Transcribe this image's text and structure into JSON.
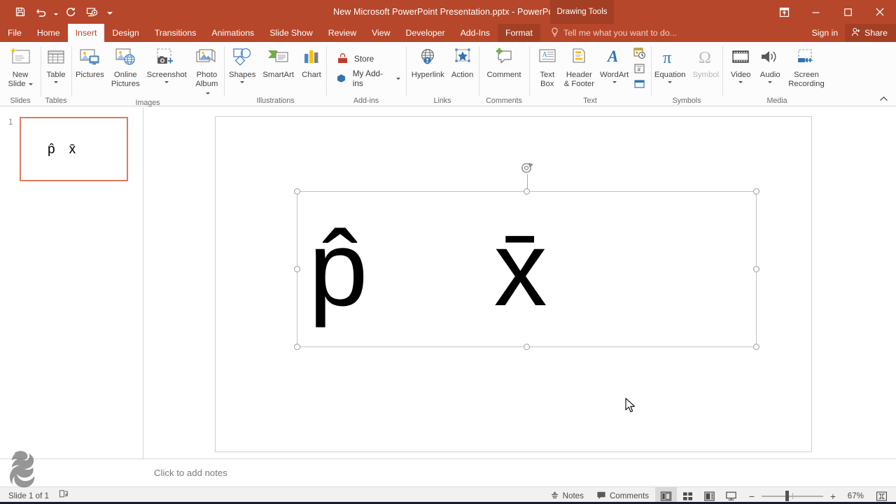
{
  "app": {
    "window_title": "New Microsoft PowerPoint Presentation.pptx - PowerPoint",
    "contextual_tabset": "Drawing Tools",
    "accent_color": "#b7472a",
    "contextual_color": "#a33f24"
  },
  "quick_access": {
    "items": [
      {
        "name": "save",
        "icon": "save-icon",
        "label": "Save"
      },
      {
        "name": "undo",
        "icon": "undo-icon",
        "label": "Undo"
      },
      {
        "name": "redo",
        "icon": "redo-icon",
        "label": "Redo"
      },
      {
        "name": "start-from-beginning",
        "icon": "slideshow-icon",
        "label": "Start From Beginning"
      },
      {
        "name": "customize",
        "icon": "chevron-down-icon",
        "label": "Customize Quick Access Toolbar"
      }
    ]
  },
  "window_controls": {
    "ribbon_display": "Ribbon Display Options",
    "minimize": "Minimize",
    "restore": "Restore Down",
    "close": "Close"
  },
  "tabs": [
    {
      "label": "File",
      "active": false,
      "contextual": false
    },
    {
      "label": "Home",
      "active": false,
      "contextual": false
    },
    {
      "label": "Insert",
      "active": true,
      "contextual": false
    },
    {
      "label": "Design",
      "active": false,
      "contextual": false
    },
    {
      "label": "Transitions",
      "active": false,
      "contextual": false
    },
    {
      "label": "Animations",
      "active": false,
      "contextual": false
    },
    {
      "label": "Slide Show",
      "active": false,
      "contextual": false
    },
    {
      "label": "Review",
      "active": false,
      "contextual": false
    },
    {
      "label": "View",
      "active": false,
      "contextual": false
    },
    {
      "label": "Developer",
      "active": false,
      "contextual": false
    },
    {
      "label": "Add-Ins",
      "active": false,
      "contextual": false
    },
    {
      "label": "Format",
      "active": false,
      "contextual": true
    }
  ],
  "tell_me": {
    "placeholder": "Tell me what you want to do...",
    "icon": "lightbulb-icon"
  },
  "account": {
    "sign_in": "Sign in",
    "share": "Share",
    "share_icon": "person-add-icon"
  },
  "ribbon": {
    "collapse_label": "Collapse the Ribbon",
    "groups": [
      {
        "name": "slides",
        "label": "Slides",
        "buttons": [
          {
            "label": "New\nSlide",
            "icon": "new-slide-icon",
            "dropdown": true,
            "disabled": false
          }
        ]
      },
      {
        "name": "tables",
        "label": "Tables",
        "buttons": [
          {
            "label": "Table",
            "icon": "table-icon",
            "dropdown": true,
            "disabled": false
          }
        ]
      },
      {
        "name": "images",
        "label": "Images",
        "buttons": [
          {
            "label": "Pictures",
            "icon": "pictures-icon",
            "dropdown": false,
            "disabled": false
          },
          {
            "label": "Online\nPictures",
            "icon": "online-pictures-icon",
            "dropdown": false,
            "disabled": false
          },
          {
            "label": "Screenshot",
            "icon": "screenshot-icon",
            "dropdown": true,
            "disabled": false
          },
          {
            "label": "Photo\nAlbum",
            "icon": "photo-album-icon",
            "dropdown": true,
            "disabled": false
          }
        ]
      },
      {
        "name": "illustrations",
        "label": "Illustrations",
        "buttons": [
          {
            "label": "Shapes",
            "icon": "shapes-icon",
            "dropdown": true,
            "disabled": false
          },
          {
            "label": "SmartArt",
            "icon": "smartart-icon",
            "dropdown": false,
            "disabled": false
          },
          {
            "label": "Chart",
            "icon": "chart-icon",
            "dropdown": false,
            "disabled": false
          }
        ]
      },
      {
        "name": "add-ins",
        "label": "Add-ins",
        "buttons": [
          {
            "label": "Store",
            "icon": "store-icon",
            "dropdown": false,
            "disabled": false
          },
          {
            "label": "My Add-ins",
            "icon": "my-addins-icon",
            "dropdown": true,
            "disabled": false
          }
        ]
      },
      {
        "name": "links",
        "label": "Links",
        "buttons": [
          {
            "label": "Hyperlink",
            "icon": "hyperlink-icon",
            "dropdown": false,
            "disabled": false
          },
          {
            "label": "Action",
            "icon": "action-icon",
            "dropdown": false,
            "disabled": false
          }
        ]
      },
      {
        "name": "comments",
        "label": "Comments",
        "buttons": [
          {
            "label": "Comment",
            "icon": "comment-icon",
            "dropdown": false,
            "disabled": false
          }
        ]
      },
      {
        "name": "text",
        "label": "Text",
        "buttons": [
          {
            "label": "Text\nBox",
            "icon": "text-box-icon",
            "dropdown": false,
            "disabled": false
          },
          {
            "label": "Header\n& Footer",
            "icon": "header-footer-icon",
            "dropdown": false,
            "disabled": false
          },
          {
            "label": "WordArt",
            "icon": "wordart-icon",
            "dropdown": true,
            "disabled": false
          }
        ],
        "small_buttons": [
          {
            "label": "Date & Time",
            "icon": "date-time-icon"
          },
          {
            "label": "Slide Number",
            "icon": "slide-number-icon"
          },
          {
            "label": "Object",
            "icon": "object-icon"
          }
        ]
      },
      {
        "name": "symbols",
        "label": "Symbols",
        "buttons": [
          {
            "label": "Equation",
            "icon": "equation-pi-icon",
            "dropdown": true,
            "disabled": false
          },
          {
            "label": "Symbol",
            "icon": "symbol-omega-icon",
            "dropdown": false,
            "disabled": true
          }
        ]
      },
      {
        "name": "media",
        "label": "Media",
        "buttons": [
          {
            "label": "Video",
            "icon": "video-icon",
            "dropdown": true,
            "disabled": false
          },
          {
            "label": "Audio",
            "icon": "audio-icon",
            "dropdown": true,
            "disabled": false
          },
          {
            "label": "Screen\nRecording",
            "icon": "screen-recording-icon",
            "dropdown": false,
            "disabled": false
          }
        ]
      }
    ]
  },
  "thumbnails": [
    {
      "number": "1",
      "selected": true,
      "symbols": [
        "p̂",
        "x̄"
      ]
    }
  ],
  "slide": {
    "selected_textbox": {
      "symbols": [
        "p̂",
        "x̄"
      ],
      "selected": true,
      "rotation_handle": "rotate-handle-icon"
    }
  },
  "notes": {
    "placeholder": "Click to add notes"
  },
  "status_bar": {
    "slide_position": "Slide 1 of 1",
    "accessibility_icon": "accessibility-checker-icon",
    "notes_button": "Notes",
    "notes_icon": "notes-icon",
    "comments_button": "Comments",
    "comments_icon": "comments-icon",
    "views": [
      {
        "name": "normal-view",
        "icon": "normal-view-icon",
        "active": true
      },
      {
        "name": "slide-sorter-view",
        "icon": "slide-sorter-icon",
        "active": false
      },
      {
        "name": "reading-view",
        "icon": "reading-view-icon",
        "active": false
      },
      {
        "name": "slide-show-view",
        "icon": "slide-show-icon",
        "active": false
      }
    ],
    "zoom_out": "−",
    "zoom_in": "+",
    "zoom_level": "67%",
    "fit_to_window": "Fit slide to current window"
  }
}
